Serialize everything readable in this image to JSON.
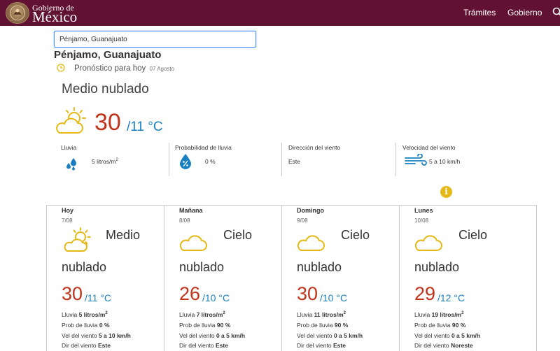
{
  "header": {
    "brand_small": "Gobierno de",
    "brand_big": "México",
    "nav": [
      "Trámites",
      "Gobierno"
    ]
  },
  "search": {
    "value": "Pénjamo, Guanajuato"
  },
  "location": "Pénjamo, Guanajuato",
  "forecast": {
    "label": "Pronóstico para hoy",
    "date": "07 Agosto"
  },
  "today": {
    "condition": "Medio nublado",
    "temp_max": "30",
    "temp_min": "/11 °C"
  },
  "stats": [
    {
      "label": "Lluvia",
      "value": "5 litros/m",
      "sup": "2",
      "icon": "raindrops-icon"
    },
    {
      "label": "Probabilidad de lluvia",
      "value": "0 %",
      "icon": "rain-probability-icon"
    },
    {
      "label": "Dirección del viento",
      "value": "Este",
      "icon": ""
    },
    {
      "label": "Velocidad del viento",
      "value": "5 a 10 km/h",
      "icon": "wind-icon"
    }
  ],
  "days": [
    {
      "day": "Hoy",
      "date": "7/08",
      "cond_a": "Medio",
      "cond_b": "nublado",
      "tmax": "30",
      "tmin": "/11 °C",
      "rain_label": "Lluvia",
      "rain": "5 litros/m",
      "rain_sup": "2",
      "prob_label": "Prob de lluvia",
      "prob": "0 %",
      "wind_label": "Vel del viento",
      "wind": "5 a 10 km/h",
      "dir_label": "Dir del viento",
      "dir": "Este",
      "icon": "partly-cloudy-icon"
    },
    {
      "day": "Mañana",
      "date": "8/08",
      "cond_a": "Cielo",
      "cond_b": "nublado",
      "tmax": "26",
      "tmin": "/10 °C",
      "rain_label": "Lluvia",
      "rain": "7 litros/m",
      "rain_sup": "2",
      "prob_label": "Prob de lluvia",
      "prob": "90 %",
      "wind_label": "Vel del viento",
      "wind": "0 a 5 km/h",
      "dir_label": "Dir del viento",
      "dir": "Este",
      "icon": "cloud-icon"
    },
    {
      "day": "Domingo",
      "date": "9/08",
      "cond_a": "Cielo",
      "cond_b": "nublado",
      "tmax": "30",
      "tmin": "/10 °C",
      "rain_label": "Lluvia",
      "rain": "11 litros/m",
      "rain_sup": "2",
      "prob_label": "Prob de lluvia",
      "prob": "90 %",
      "wind_label": "Vel del viento",
      "wind": "0 a 5 km/h",
      "dir_label": "Dir del viento",
      "dir": "Este",
      "icon": "cloud-icon"
    },
    {
      "day": "Lunes",
      "date": "10/08",
      "cond_a": "Cielo",
      "cond_b": "nublado",
      "tmax": "29",
      "tmin": "/12 °C",
      "rain_label": "Lluvia",
      "rain": "19 litros/m",
      "rain_sup": "2",
      "prob_label": "Prob de lluvia",
      "prob": "90 %",
      "wind_label": "Vel del viento",
      "wind": "0 a 5 km/h",
      "dir_label": "Dir del viento",
      "dir": "Noreste",
      "icon": "cloud-icon"
    }
  ],
  "colors": {
    "header_bg": "#611232",
    "temp_max": "#c1331b",
    "temp_min": "#1a7fc1",
    "icon_yellow": "#e4b915"
  }
}
